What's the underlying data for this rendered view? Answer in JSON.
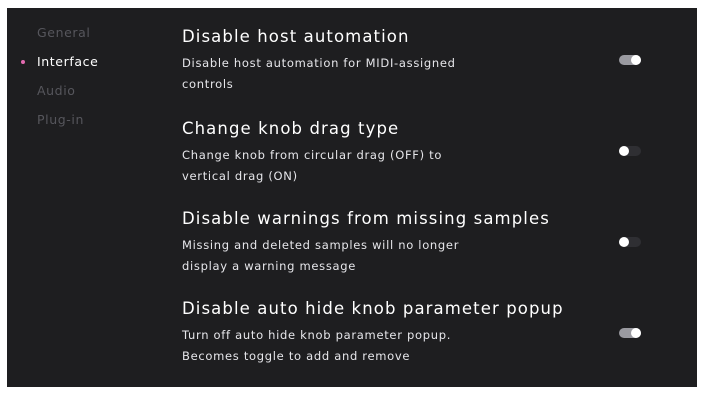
{
  "sidebar": {
    "items": [
      {
        "label": "General",
        "active": false
      },
      {
        "label": "Interface",
        "active": true
      },
      {
        "label": "Audio",
        "active": false
      },
      {
        "label": "Plug-in",
        "active": false
      }
    ]
  },
  "settings": [
    {
      "title": "Disable host automation",
      "description_lines": [
        "Disable host automation for MIDI-assigned",
        "controls"
      ],
      "enabled": true
    },
    {
      "title": "Change knob drag type",
      "description_lines": [
        "Change knob from circular drag (OFF) to",
        "vertical drag (ON)"
      ],
      "enabled": false
    },
    {
      "title": "Disable warnings from missing samples",
      "description_lines": [
        "Missing and deleted samples will no longer",
        "display a warning message"
      ],
      "enabled": false
    },
    {
      "title": "Disable auto hide knob parameter popup",
      "description_lines": [
        "Turn off auto hide knob parameter popup.",
        "Becomes toggle to add and remove"
      ],
      "enabled": true
    }
  ],
  "colors": {
    "background": "#1e1e20",
    "accent_dot": "#e36bb0",
    "toggle_on": "#9a9aa0",
    "toggle_off": "#2f2f33",
    "inactive_nav": "#56565c"
  }
}
